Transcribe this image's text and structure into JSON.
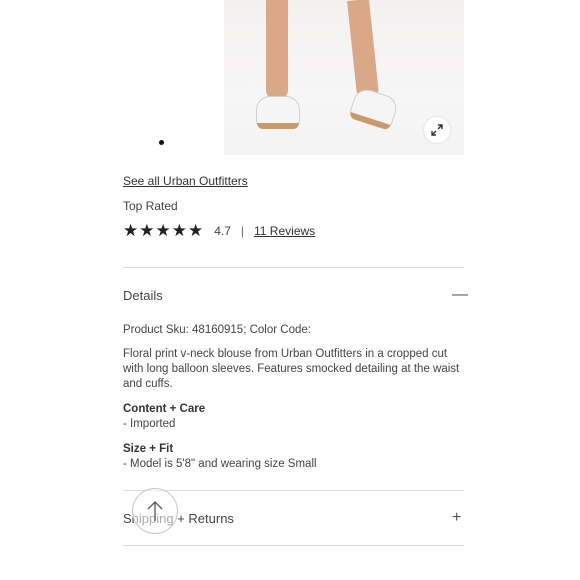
{
  "brand_link": "See all Urban Outfitters",
  "badge": "Top Rated",
  "rating": {
    "stars": "★★★★★",
    "value": "4.7",
    "separator": "|",
    "reviews": "11 Reviews"
  },
  "details": {
    "title": "Details",
    "toggle": "—",
    "sku_line": "Product Sku: 48160915; Color Code:",
    "description": "Floral print v-neck blouse from Urban Outfitters in a cropped cut with long balloon sleeves. Features smocked detailing at the waist and cuffs.",
    "content_title": "Content + Care",
    "content_value": "- Imported",
    "size_title": "Size + Fit",
    "size_value": "- Model is 5'8\" and wearing size Small"
  },
  "shipping": {
    "title": "Shipping + Returns",
    "toggle": "+"
  },
  "icons": {
    "expand": "expand-icon",
    "scroll": "arrow-up-icon"
  }
}
